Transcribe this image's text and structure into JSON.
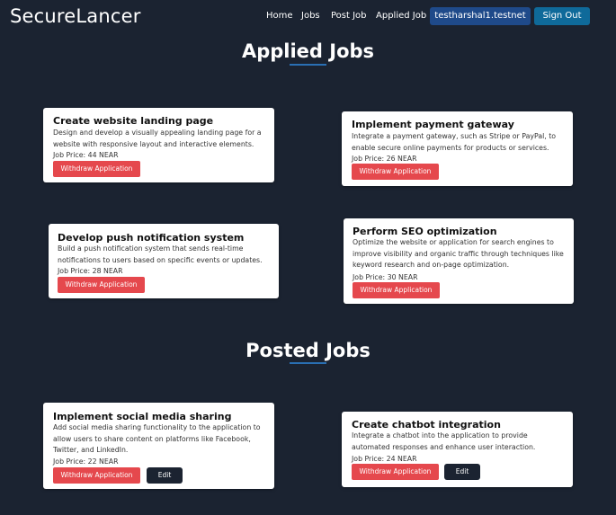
{
  "app": {
    "brand": "SecureLancer"
  },
  "nav": {
    "home": "Home",
    "jobs": "Jobs",
    "post_job": "Post Job",
    "applied_job": "Applied Job",
    "account": "testharshal1.testnet",
    "sign_out": "Sign Out"
  },
  "applied_section": {
    "title": "Applied Jobs",
    "jobs": [
      {
        "title": "Create website landing page",
        "description": "Design and develop a visually appealing landing page for a website with responsive layout and interactive elements.",
        "price": "Job Price: 44 NEAR",
        "withdraw_label": "Withdraw Application"
      },
      {
        "title": "Implement payment gateway",
        "description": "Integrate a payment gateway, such as Stripe or PayPal, to enable secure online payments for products or services.",
        "price": "Job Price: 26 NEAR",
        "withdraw_label": "Withdraw Application"
      },
      {
        "title": "Develop push notification system",
        "description": "Build a push notification system that sends real-time notifications to users based on specific events or updates.",
        "price": "Job Price: 28 NEAR",
        "withdraw_label": "Withdraw Application"
      },
      {
        "title": "Perform SEO optimization",
        "description": "Optimize the website or application for search engines to improve visibility and organic traffic through techniques like keyword research and on-page optimization.",
        "price": "Job Price: 30 NEAR",
        "withdraw_label": "Withdraw Application"
      }
    ]
  },
  "posted_section": {
    "title": "Posted Jobs",
    "jobs": [
      {
        "title": "Implement social media sharing",
        "description": "Add social media sharing functionality to the application to allow users to share content on platforms like Facebook, Twitter, and LinkedIn.",
        "price": "Job Price: 22 NEAR",
        "withdraw_label": "Withdraw Application",
        "edit_label": "Edit"
      },
      {
        "title": "Create chatbot integration",
        "description": "Integrate a chatbot into the application to provide automated responses and enhance user interaction.",
        "price": "Job Price: 24 NEAR",
        "withdraw_label": "Withdraw Application",
        "edit_label": "Edit"
      }
    ]
  },
  "colors": {
    "background": "#1b2331",
    "card": "#ffffff",
    "withdraw_button": "#e5484d",
    "account_button": "#1f4a8a",
    "signout_button": "#0f6a9a",
    "title_underline": "#2a6fb3"
  }
}
